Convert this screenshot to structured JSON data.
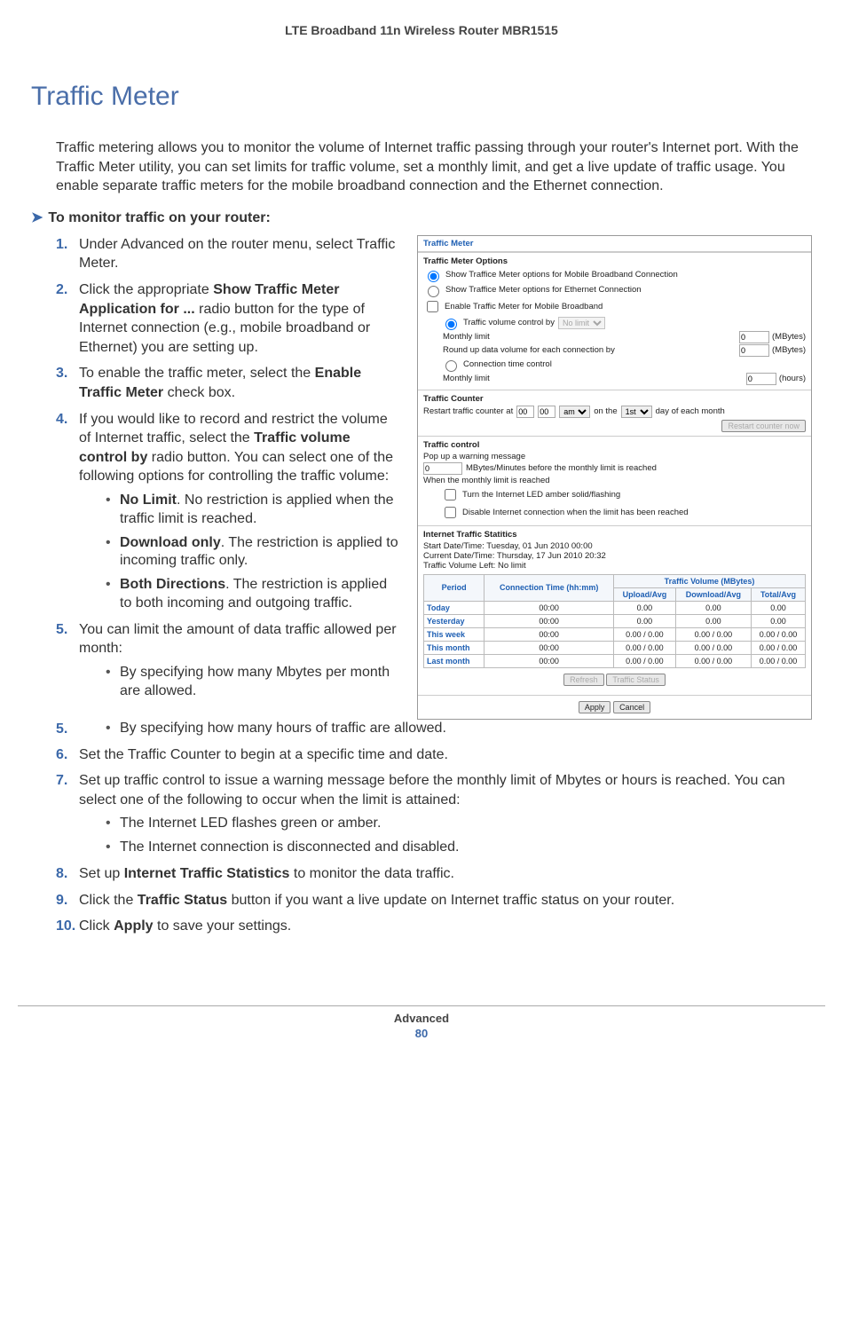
{
  "header": {
    "doc_title": "LTE Broadband 11n Wireless Router MBR1515"
  },
  "title": "Traffic Meter",
  "intro": "Traffic metering allows you to monitor the volume of Internet traffic passing through your router's Internet port. With the Traffic Meter utility, you can set limits for traffic volume, set a monthly limit, and get a live update of traffic usage. You enable separate traffic meters for the mobile broadband connection and the Ethernet connection.",
  "procedure_heading": "To monitor traffic on your router:",
  "steps": {
    "s1": "Under Advanced on the router menu, select Traffic Meter.",
    "s2_a": "Click the appropriate ",
    "s2_b": "Show Traffic Meter Application for ...",
    "s2_c": " radio button for the type of Internet connection (e.g., mobile broadband or Ethernet) you are setting up.",
    "s3_a": "To enable the traffic meter, select the ",
    "s3_b": "Enable Traffic Meter",
    "s3_c": " check box.",
    "s4_a": "If you would like to record and restrict the volume of Internet traffic, select the ",
    "s4_b": "Traffic volume control by",
    "s4_c": " radio button. You can select one of the following options for controlling the traffic volume:",
    "s4_b1_t": "No Limit",
    "s4_b1": ". No restriction is applied when the traffic limit is reached.",
    "s4_b2_t": "Download only",
    "s4_b2": ". The restriction is applied to incoming traffic only.",
    "s4_b3_t": "Both Directions",
    "s4_b3": ". The restriction is applied to both incoming and outgoing traffic.",
    "s5": "You can limit the amount of data traffic allowed per month:",
    "s5_b1": "By specifying how many Mbytes per month are allowed.",
    "s5_b2": "By specifying how many hours of traffic are allowed.",
    "s6": "Set the Traffic Counter to begin at a specific time and date.",
    "s7": "Set up traffic control to issue a warning message before the monthly limit of Mbytes or hours is reached. You can select one of the following to occur when the limit is attained:",
    "s7_b1": "The Internet LED flashes green or amber.",
    "s7_b2": "The Internet connection is disconnected and disabled.",
    "s8_a": "Set up ",
    "s8_b": "Internet Traffic Statistics",
    "s8_c": " to monitor the data traffic.",
    "s9_a": "Click the ",
    "s9_b": "Traffic Status",
    "s9_c": " button if you want a live update on Internet traffic status on your router.",
    "s10_a": "Click ",
    "s10_b": "Apply",
    "s10_c": " to save your settings."
  },
  "shot": {
    "title": "Traffic Meter",
    "options_title": "Traffic Meter Options",
    "opt_mobile": "Show Traffice Meter options for Mobile Broadband Connection",
    "opt_eth": "Show Traffice Meter options for Ethernet Connection",
    "enable": "Enable Traffic Meter for Mobile Broadband",
    "vol_ctrl": "Traffic volume control by",
    "vol_sel": "No limit",
    "monthly_limit": "Monthly limit",
    "mbytes": "(MBytes)",
    "roundup": "Round up data volume for each connection by",
    "conn_time": "Connection time control",
    "hours": "(hours)",
    "counter_title": "Traffic Counter",
    "restart_a": "Restart traffic counter at",
    "restart_hh": "00",
    "restart_mm": "00",
    "restart_ampm": "am",
    "restart_b": "on the",
    "restart_day": "1st",
    "restart_c": "day of each month",
    "restart_btn": "Restart counter now",
    "control_title": "Traffic control",
    "popup": "Pop up a warning message",
    "mb_min": "MBytes/Minutes before the monthly limit is reached",
    "when_reached": "When the monthly limit is reached",
    "led": "Turn the Internet LED amber solid/flashing",
    "disable": "Disable Internet connection when the limit has been reached",
    "stats_title": "Internet Traffic Statitics",
    "start_dt": "Start Date/Time: Tuesday, 01 Jun 2010 00:00",
    "curr_dt": "Current Date/Time: Thursday, 17 Jun 2010 20:32",
    "vol_left": "Traffic Volume Left: No limit",
    "th_period": "Period",
    "th_conn": "Connection Time (hh:mm)",
    "th_vol": "Traffic Volume (MBytes)",
    "th_up": "Upload/Avg",
    "th_dl": "Download/Avg",
    "th_tot": "Total/Avg",
    "rows": [
      {
        "p": "Today",
        "c": "00:00",
        "u": "0.00",
        "d": "0.00",
        "t": "0.00"
      },
      {
        "p": "Yesterday",
        "c": "00:00",
        "u": "0.00",
        "d": "0.00",
        "t": "0.00"
      },
      {
        "p": "This week",
        "c": "00:00",
        "u": "0.00 / 0.00",
        "d": "0.00 / 0.00",
        "t": "0.00 / 0.00"
      },
      {
        "p": "This month",
        "c": "00:00",
        "u": "0.00 / 0.00",
        "d": "0.00 / 0.00",
        "t": "0.00 / 0.00"
      },
      {
        "p": "Last month",
        "c": "00:00",
        "u": "0.00 / 0.00",
        "d": "0.00 / 0.00",
        "t": "0.00 / 0.00"
      }
    ],
    "refresh": "Refresh",
    "traffic_status": "Traffic Status",
    "apply": "Apply",
    "cancel": "Cancel",
    "zero": "0"
  },
  "footer": {
    "section": "Advanced",
    "page": "80"
  }
}
